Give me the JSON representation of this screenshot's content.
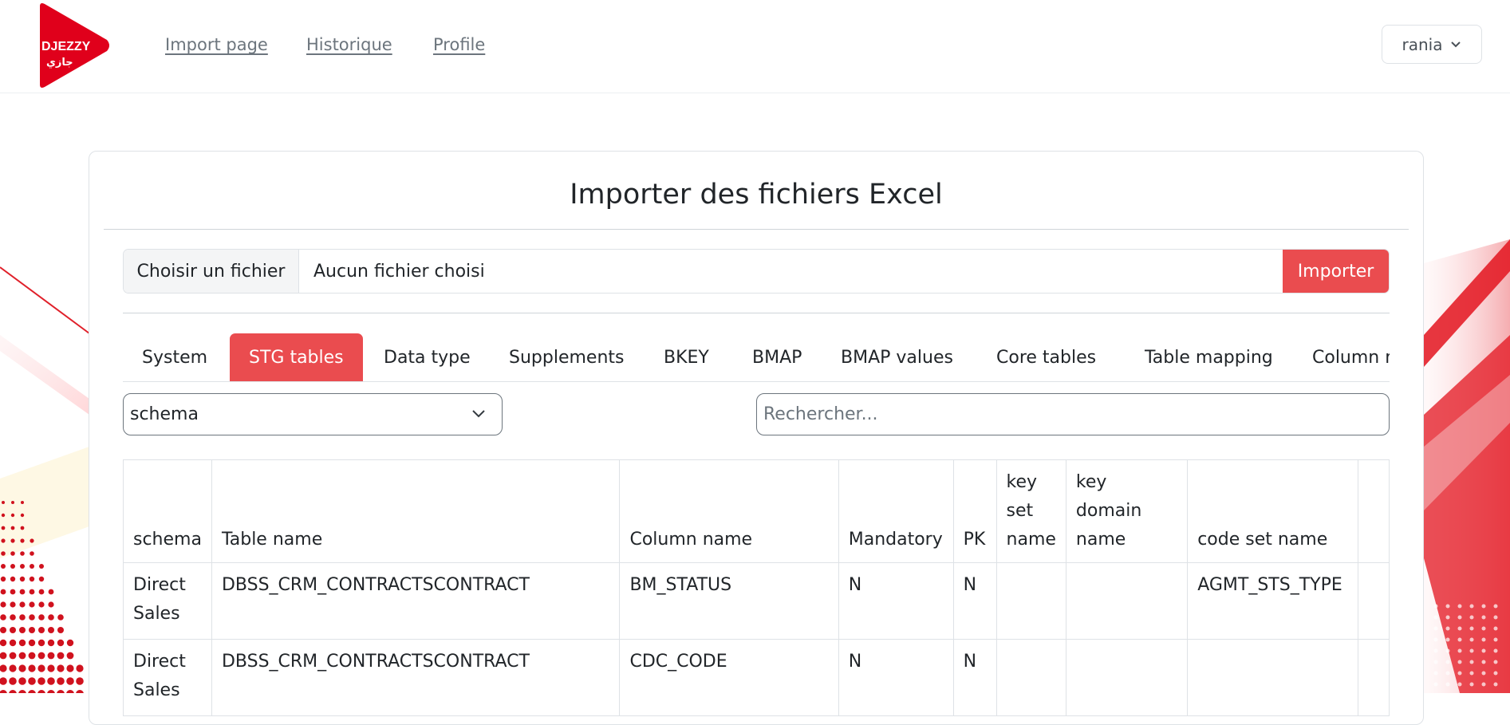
{
  "brand": {
    "name": "DJEZZY",
    "arabic_name": "جازي",
    "color": "#e0001b"
  },
  "nav": [
    {
      "label": "Import page"
    },
    {
      "label": "Historique"
    },
    {
      "label": "Profile"
    }
  ],
  "user": {
    "name": "rania",
    "icon": "chevron-down-icon"
  },
  "card": {
    "title": "Importer des fichiers Excel"
  },
  "file_input": {
    "choose_label": "Choisir un fichier",
    "file_name": "Aucun fichier choisi",
    "import_label": "Importer"
  },
  "tabs": [
    {
      "label": "System"
    },
    {
      "label": "STG tables",
      "active": true
    },
    {
      "label": "Data type"
    },
    {
      "label": "Supplements"
    },
    {
      "label": "BKEY"
    },
    {
      "label": "BMAP"
    },
    {
      "label": "BMAP values"
    },
    {
      "label": "Core tables"
    },
    {
      "label": "Table mapping"
    },
    {
      "label": "Column m"
    }
  ],
  "filters": {
    "schema_selected": "schema",
    "search_placeholder": "Rechercher..."
  },
  "table": {
    "headers": [
      "schema",
      "Table name",
      "Column name",
      "Mandatory",
      "PK",
      "key set name",
      "key domain name",
      "code set name"
    ],
    "rows": [
      [
        "Direct Sales",
        "DBSS_CRM_CONTRACTSCONTRACT",
        "BM_STATUS",
        "N",
        "N",
        "",
        "",
        "AGMT_STS_TYPE"
      ],
      [
        "Direct Sales",
        "DBSS_CRM_CONTRACTSCONTRACT",
        "CDC_CODE",
        "N",
        "N",
        "",
        "",
        ""
      ]
    ]
  },
  "colors": {
    "accent": "#ea4c4f",
    "border": "#dee2e6",
    "muted_text": "#6c757d"
  }
}
